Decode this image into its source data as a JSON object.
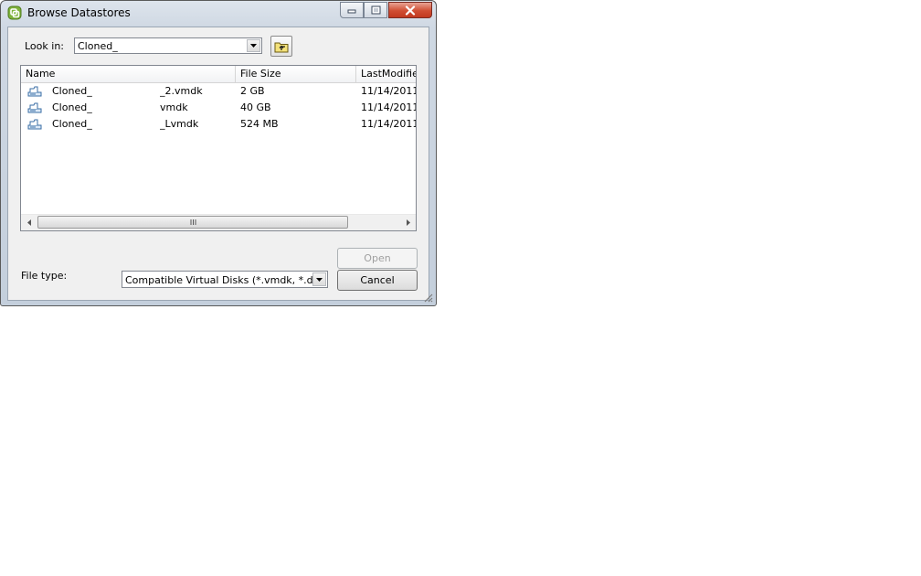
{
  "window": {
    "title": "Browse Datastores",
    "app_icon": "vsphere-icon"
  },
  "look_in": {
    "label": "Look in:",
    "value": "Cloned_"
  },
  "toolbar": {
    "up_icon": "up-folder-icon"
  },
  "file_list": {
    "columns": [
      "Name",
      "File Size",
      "LastModifie"
    ],
    "rows": [
      {
        "name": "Cloned_",
        "suffix": "_2.vmdk",
        "size": "2 GB",
        "modified": "11/14/2011"
      },
      {
        "name": "Cloned_",
        "suffix": "vmdk",
        "size": "40 GB",
        "modified": "11/14/2011"
      },
      {
        "name": "Cloned_",
        "suffix": "_Lvmdk",
        "size": "524 MB",
        "modified": "11/14/2011"
      }
    ],
    "row_icon": "virtual-disk-icon"
  },
  "file_type": {
    "label": "File type:",
    "value": "Compatible Virtual Disks (*.vmdk, *.dsk, *."
  },
  "buttons": {
    "open": "Open",
    "cancel": "Cancel"
  },
  "colors": {
    "title_gradient": "#cfd8e3",
    "close_button": "#d04d32",
    "client_bg": "#f0f0f0"
  }
}
